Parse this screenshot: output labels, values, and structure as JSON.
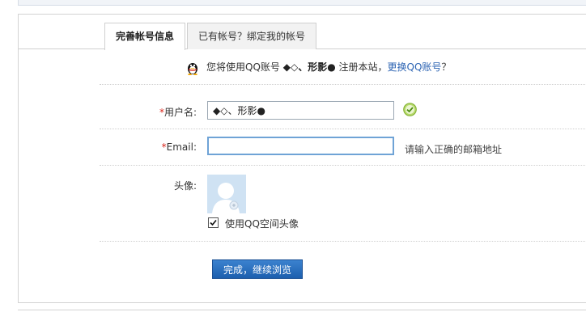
{
  "tabs": [
    {
      "label": "完善帐号信息",
      "active": true
    },
    {
      "label": "已有帐号？绑定我的帐号",
      "active": false
    }
  ],
  "notice": {
    "prefix": "您将使用QQ账号",
    "nickname": "◆◇、形影●",
    "middle": "注册本站，",
    "link": "更换QQ账号",
    "suffix": "？",
    "icon": "qq-penguin-icon"
  },
  "form": {
    "username_required_mark": "*",
    "username_label": "用户名:",
    "username_value": "◆◇、形影●",
    "username_status_icon": "check-circle-icon",
    "email_required_mark": "*",
    "email_label": "Email:",
    "email_value": "",
    "email_hint": "请输入正确的邮箱地址",
    "avatar_label": "头像:",
    "use_qq_avatar_label": "使用QQ空间头像",
    "use_qq_avatar_checked": true,
    "submit_label": "完成，继续浏览"
  },
  "colors": {
    "link": "#2d64b3",
    "required": "#d9261c",
    "button": "#2468b8",
    "email_focus_border": "#6fa3d6"
  }
}
